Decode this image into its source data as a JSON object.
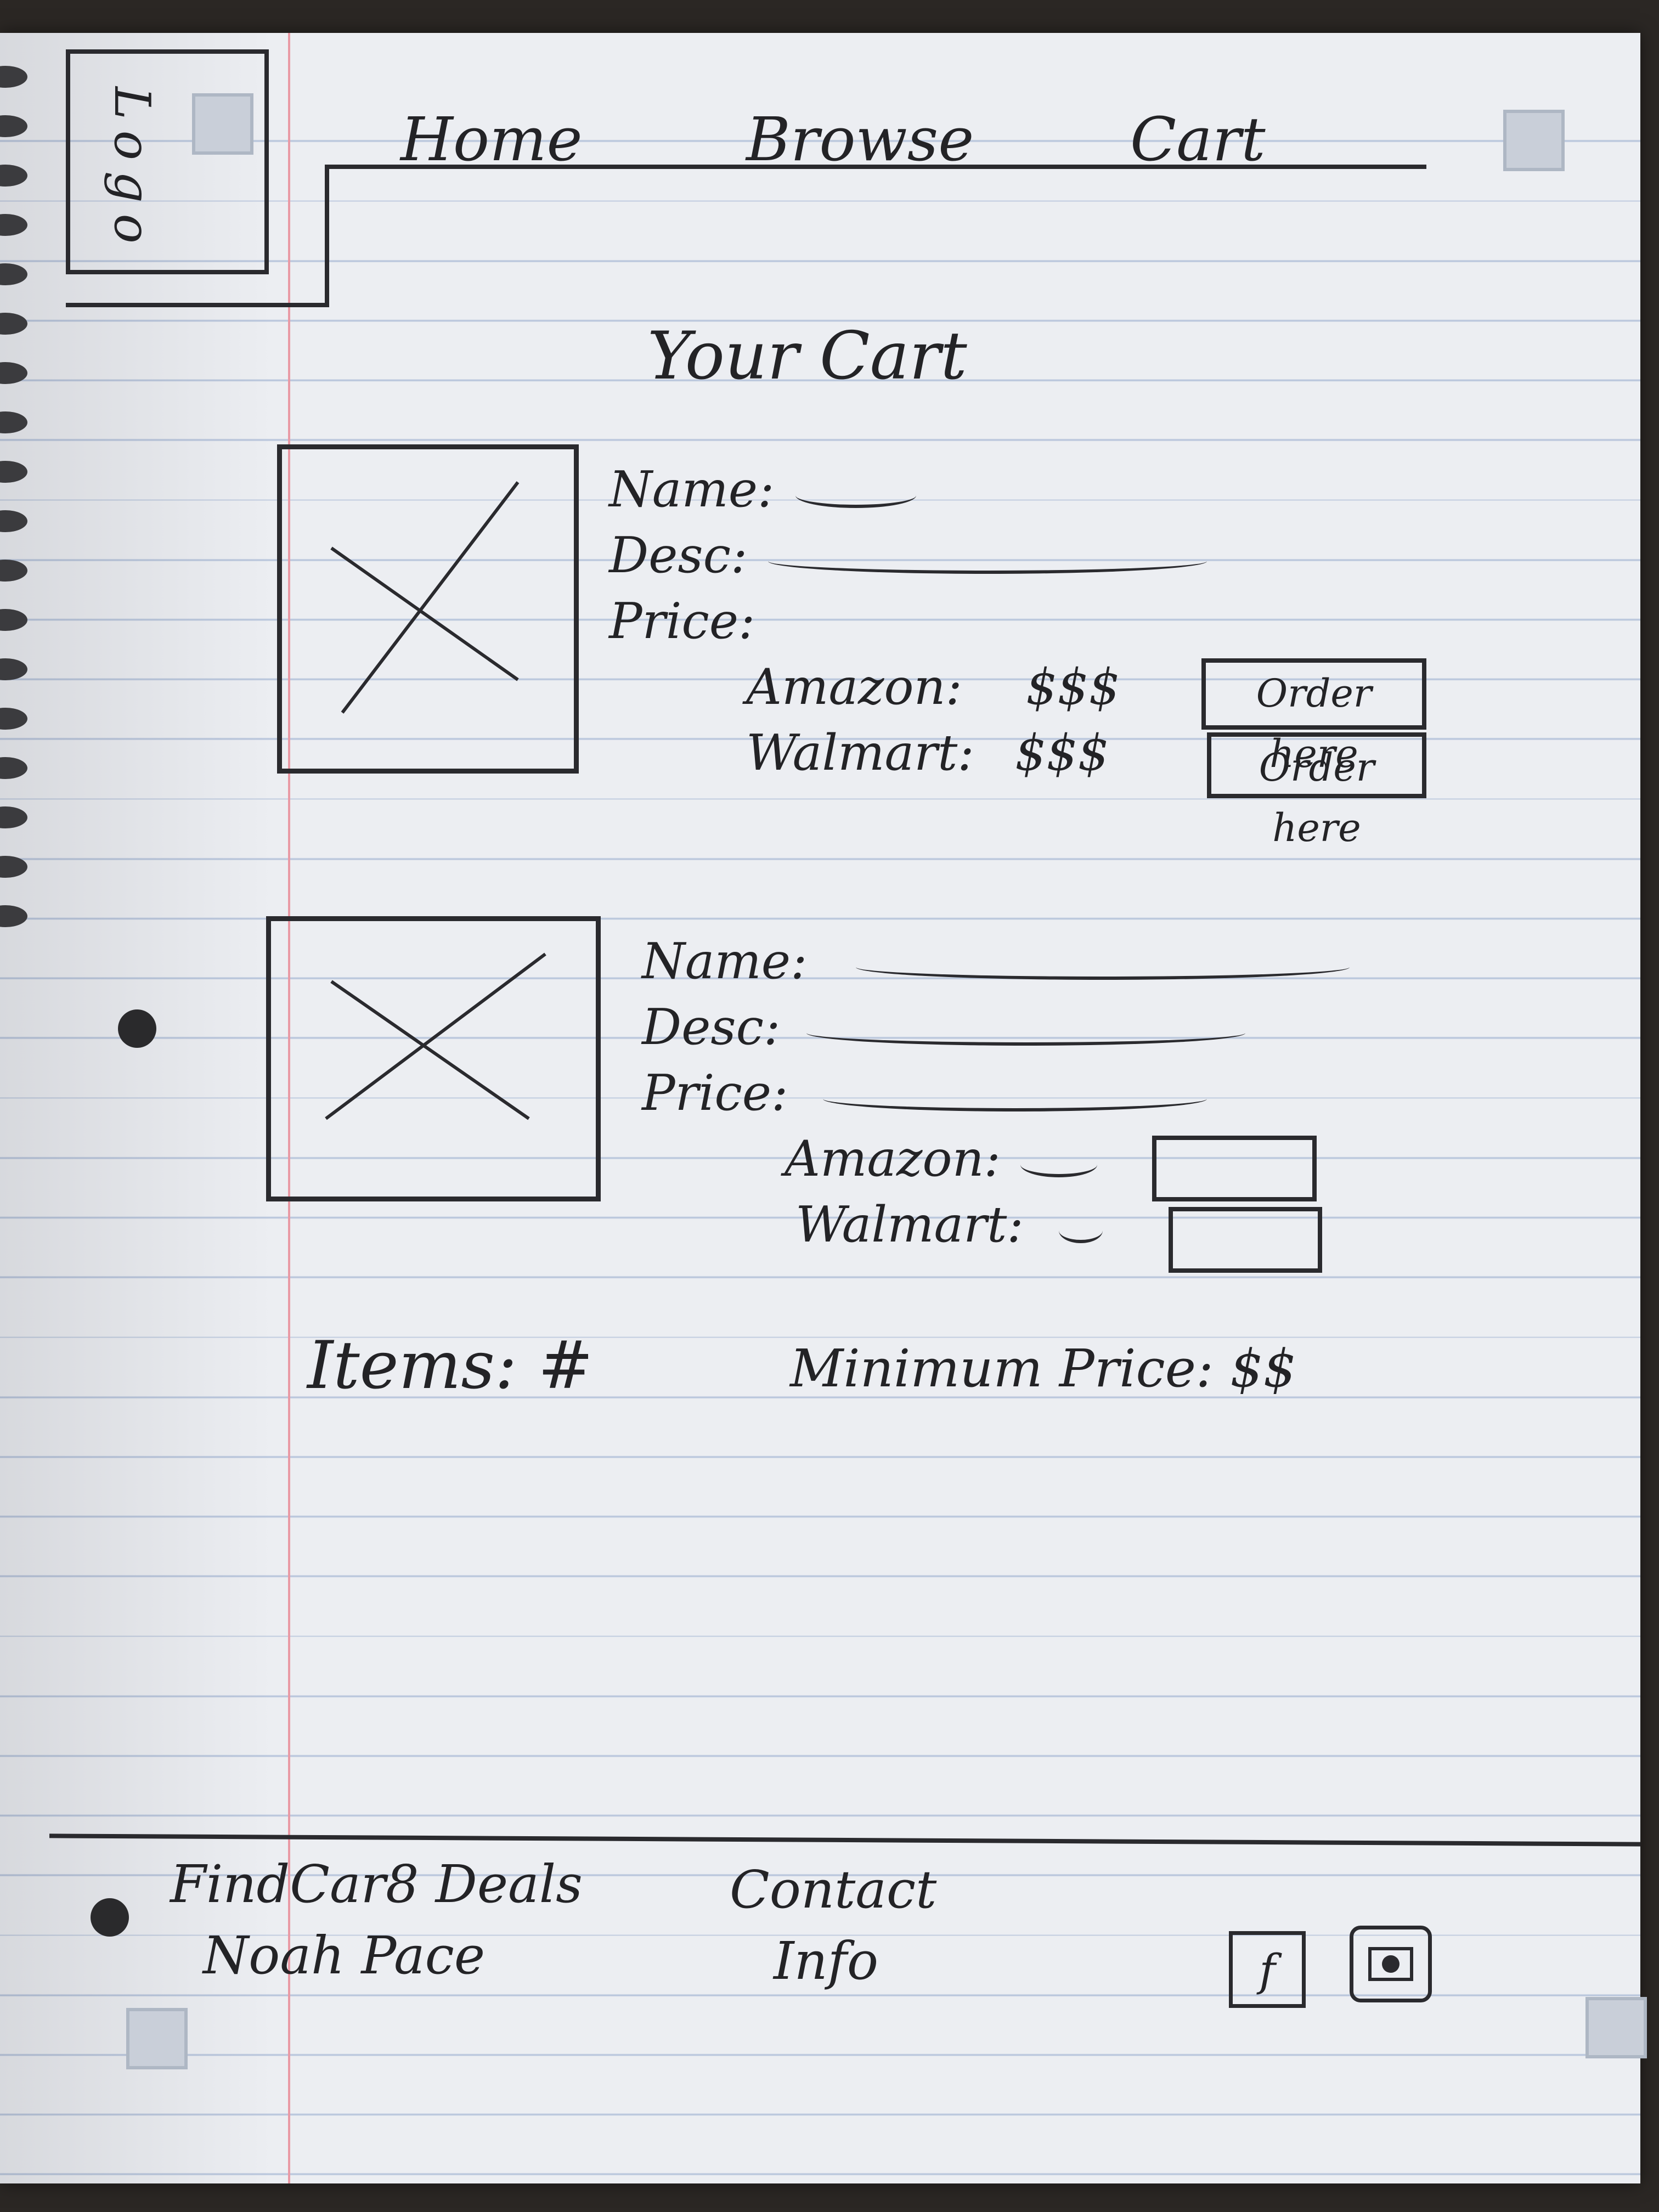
{
  "header": {
    "logo_text": "Logo",
    "nav": {
      "home": "Home",
      "browse": "Browse",
      "cart": "Cart"
    }
  },
  "page_title": "Your Cart",
  "items": [
    {
      "name_label": "Name:",
      "desc_label": "Desc:",
      "price_label": "Price:",
      "amazon_label": "Amazon:",
      "amazon_price": "$$$",
      "walmart_label": "Walmart:",
      "walmart_price": "$$$",
      "order_button_label": "Order here"
    },
    {
      "name_label": "Name:",
      "desc_label": "Desc:",
      "price_label": "Price:",
      "amazon_label": "Amazon:",
      "walmart_label": "Walmart:"
    }
  ],
  "summary": {
    "items_text": "Items: #",
    "min_price_text": "Minimum Price: $$"
  },
  "footer": {
    "brand": "FindCar8 Deals",
    "author": "Noah Pace",
    "contact_line1": "Contact",
    "contact_line2": "Info",
    "facebook_glyph": "f",
    "icons": [
      "facebook-icon",
      "instagram-icon"
    ]
  },
  "colors": {
    "ink": "#232326",
    "paper": "#eceef2",
    "rule": "#b9c6dc",
    "margin": "#e99aa5"
  }
}
